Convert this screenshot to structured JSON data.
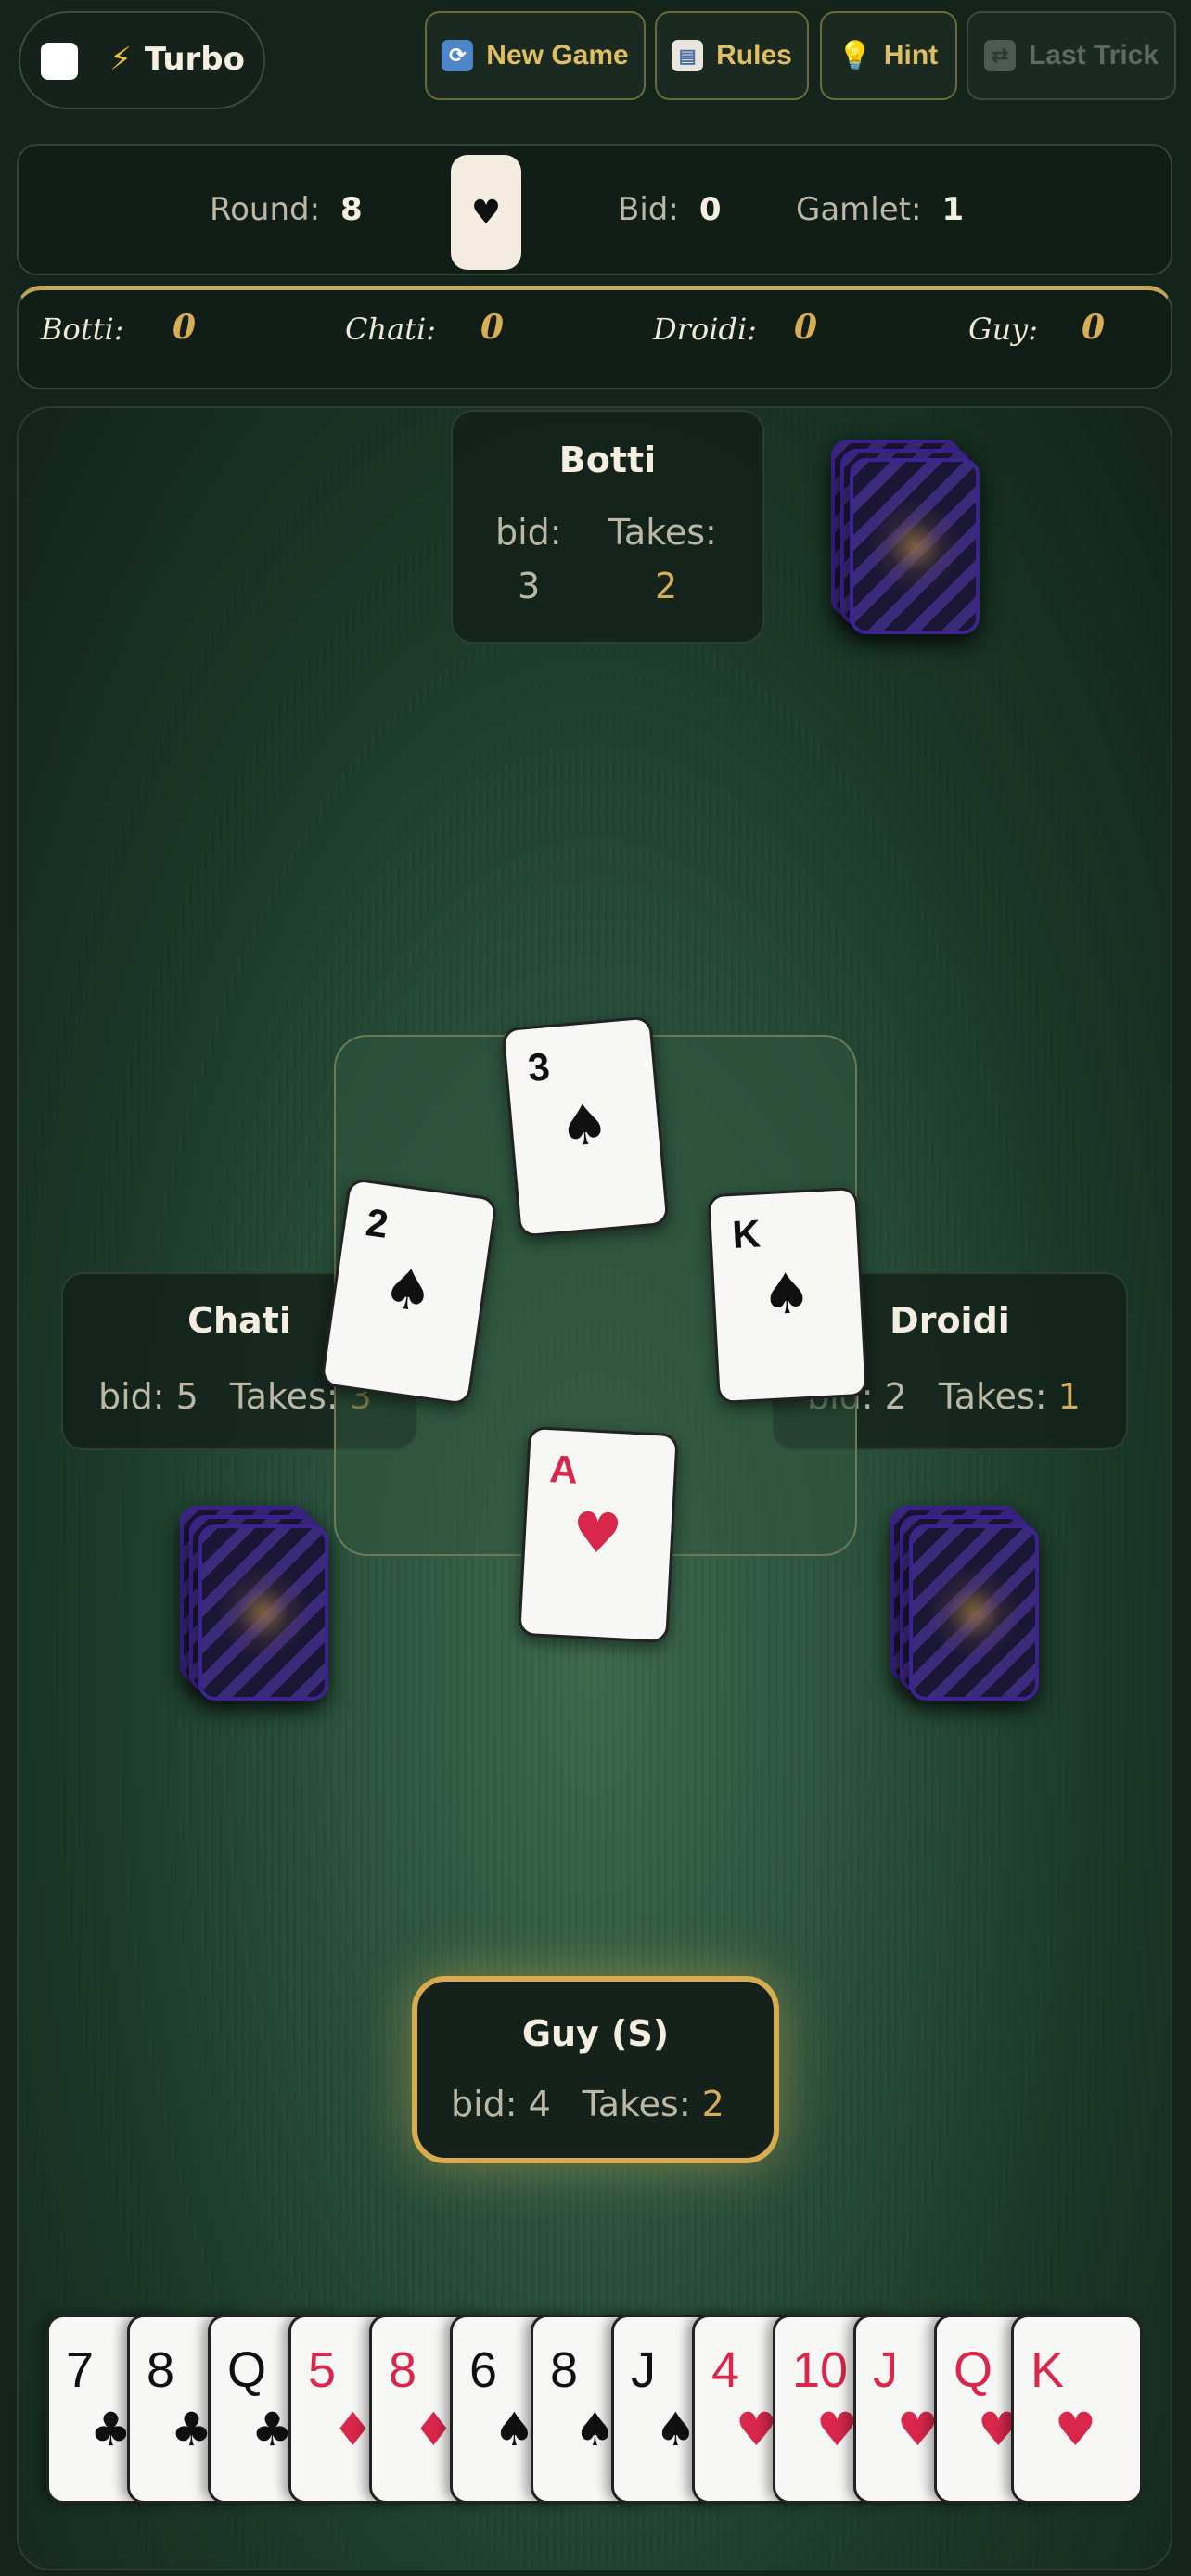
{
  "toolbar": {
    "turbo_label": "Turbo",
    "turbo_checked": false,
    "buttons": [
      {
        "label": "New Game",
        "icon": "refresh-icon",
        "enabled": true
      },
      {
        "label": "Rules",
        "icon": "book-icon",
        "enabled": true
      },
      {
        "label": "Hint",
        "icon": "lightbulb-icon",
        "enabled": true
      },
      {
        "label": "Last Trick",
        "icon": "repeat-icon",
        "enabled": false
      }
    ]
  },
  "info": {
    "round_label": "Round:",
    "round_value": "8",
    "trump_suit": "♥",
    "bid_label": "Bid:",
    "bid_value": "0",
    "gamlet_label": "Gamlet:",
    "gamlet_value": "1"
  },
  "scores": [
    {
      "name": "Botti:",
      "value": "0"
    },
    {
      "name": "Chati:",
      "value": "0"
    },
    {
      "name": "Droidi:",
      "value": "0"
    },
    {
      "name": "Guy:",
      "value": "0"
    }
  ],
  "players": {
    "north": {
      "name": "Botti",
      "bid_label": "bid:",
      "bid": "3",
      "takes_label": "Takes:",
      "takes": "2"
    },
    "west": {
      "name": "Chati",
      "bid_label": "bid:",
      "bid": "5",
      "takes_label": "Takes:",
      "takes": "3"
    },
    "east": {
      "name": "Droidi",
      "bid_label": "bid:",
      "bid": "2",
      "takes_label": "Takes:",
      "takes": "1"
    },
    "south": {
      "name": "Guy (S)",
      "bid_label": "bid:",
      "bid": "4",
      "takes_label": "Takes:",
      "takes": "2"
    }
  },
  "trick": {
    "north": {
      "rank": "3",
      "suit": "♠",
      "color": "black"
    },
    "west": {
      "rank": "2",
      "suit": "♠",
      "color": "black"
    },
    "east": {
      "rank": "K",
      "suit": "♠",
      "color": "black"
    },
    "south": {
      "rank": "A",
      "suit": "♥",
      "color": "red"
    }
  },
  "hand": [
    {
      "rank": "7",
      "suit": "♣",
      "color": "black"
    },
    {
      "rank": "8",
      "suit": "♣",
      "color": "black"
    },
    {
      "rank": "Q",
      "suit": "♣",
      "color": "black"
    },
    {
      "rank": "5",
      "suit": "♦",
      "color": "red"
    },
    {
      "rank": "8",
      "suit": "♦",
      "color": "red"
    },
    {
      "rank": "6",
      "suit": "♠",
      "color": "black"
    },
    {
      "rank": "8",
      "suit": "♠",
      "color": "black"
    },
    {
      "rank": "J",
      "suit": "♠",
      "color": "black"
    },
    {
      "rank": "4",
      "suit": "♥",
      "color": "red"
    },
    {
      "rank": "10",
      "suit": "♥",
      "color": "red"
    },
    {
      "rank": "J",
      "suit": "♥",
      "color": "red"
    },
    {
      "rank": "Q",
      "suit": "♥",
      "color": "red"
    },
    {
      "rank": "K",
      "suit": "♥",
      "color": "red"
    }
  ],
  "colors": {
    "accent_gold": "#d9ad54",
    "card_back": "#3c2a7a",
    "red_suit": "#d8274a"
  }
}
